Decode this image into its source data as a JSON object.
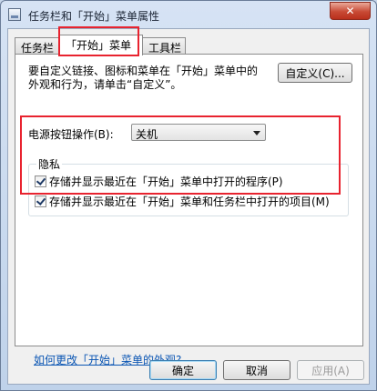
{
  "window": {
    "title": "任务栏和「开始」菜单属性",
    "close_label": "✕"
  },
  "tabs": [
    {
      "label": "任务栏"
    },
    {
      "label": "「开始」菜单"
    },
    {
      "label": "工具栏"
    }
  ],
  "start_menu": {
    "description": "要自定义链接、图标和菜单在「开始」菜单中的外观和行为，请单击“自定义”。",
    "customize_label": "自定义(C)...",
    "power_label": "电源按钮操作(B):",
    "power_value": "关机",
    "privacy": {
      "legend": "隐私",
      "items": [
        {
          "label": "存储并显示最近在「开始」菜单中打开的程序(P)",
          "checked": true
        },
        {
          "label": "存储并显示最近在「开始」菜单和任务栏中打开的项目(M)",
          "checked": true
        }
      ]
    },
    "help_link": "如何更改「开始」菜单的外观?"
  },
  "footer": {
    "ok_label": "确定",
    "cancel_label": "取消",
    "apply_label": "应用(A)"
  },
  "colors": {
    "highlight_box": "#e8232f",
    "link": "#0a55b3"
  }
}
